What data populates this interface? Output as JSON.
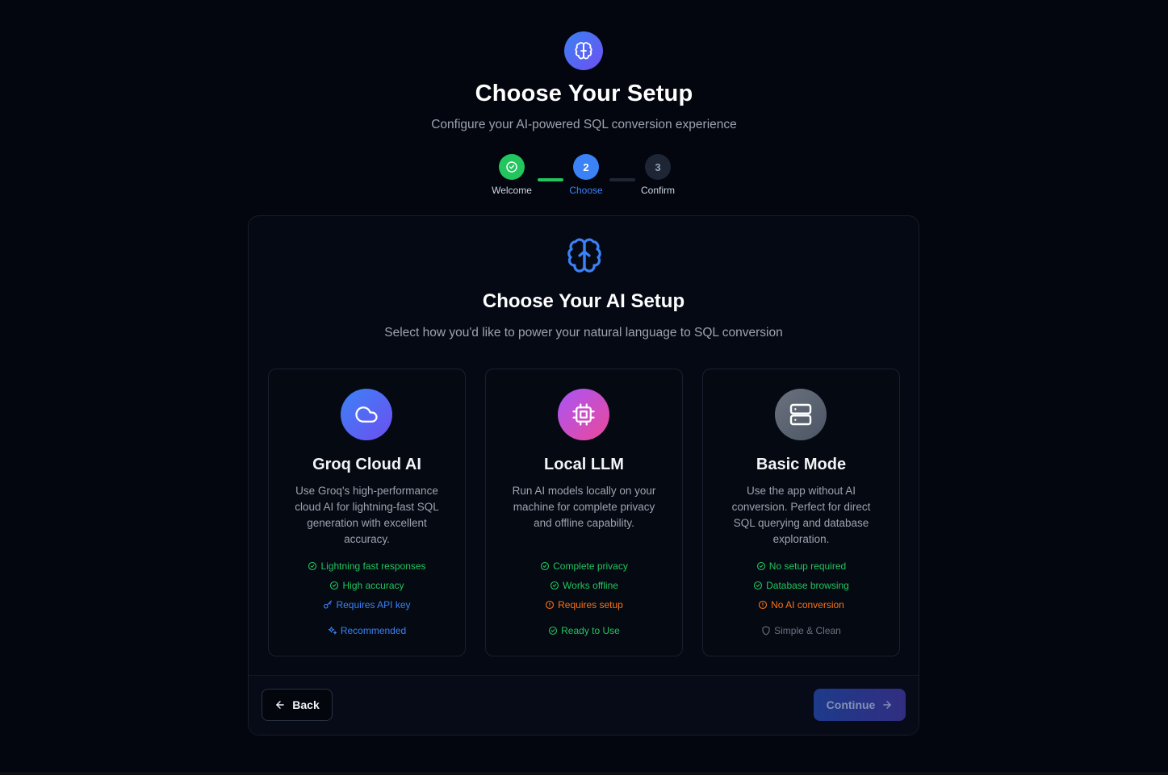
{
  "header": {
    "logo_icon": "brain-icon",
    "title": "Choose Your Setup",
    "subtitle": "Configure your AI-powered SQL conversion experience"
  },
  "steps": [
    {
      "number": "",
      "label": "Welcome",
      "state": "complete",
      "icon": "check-circle-icon"
    },
    {
      "number": "2",
      "label": "Choose",
      "state": "active"
    },
    {
      "number": "3",
      "label": "Confirm",
      "state": "pending"
    }
  ],
  "card": {
    "icon": "brain-icon",
    "title": "Choose Your AI Setup",
    "subtitle": "Select how you'd like to power your natural language to SQL conversion"
  },
  "options": [
    {
      "icon": "cloud-icon",
      "title": "Groq Cloud AI",
      "description": "Use Groq's high-performance cloud AI for lightning-fast SQL generation with excellent accuracy.",
      "features": [
        {
          "text": "Lightning fast responses",
          "type": "positive"
        },
        {
          "text": "High accuracy",
          "type": "positive"
        },
        {
          "text": "Requires API key",
          "type": "info"
        }
      ],
      "badge": {
        "text": "Recommended",
        "type": "info"
      }
    },
    {
      "icon": "cpu-icon",
      "title": "Local LLM",
      "description": "Run AI models locally on your machine for complete privacy and offline capability.",
      "features": [
        {
          "text": "Complete privacy",
          "type": "positive"
        },
        {
          "text": "Works offline",
          "type": "positive"
        },
        {
          "text": "Requires setup",
          "type": "warning"
        }
      ],
      "badge": {
        "text": "Ready to Use",
        "type": "positive"
      }
    },
    {
      "icon": "server-icon",
      "title": "Basic Mode",
      "description": "Use the app without AI conversion. Perfect for direct SQL querying and database exploration.",
      "features": [
        {
          "text": "No setup required",
          "type": "positive"
        },
        {
          "text": "Database browsing",
          "type": "positive"
        },
        {
          "text": "No AI conversion",
          "type": "warning"
        }
      ],
      "badge": {
        "text": "Simple & Clean",
        "type": "neutral"
      }
    }
  ],
  "footer": {
    "back_label": "Back",
    "continue_label": "Continue"
  },
  "colors": {
    "background": "#03060f",
    "accent": "#3b82f6",
    "success": "#22c55e",
    "warning": "#f97316",
    "muted": "#9ca3af"
  }
}
